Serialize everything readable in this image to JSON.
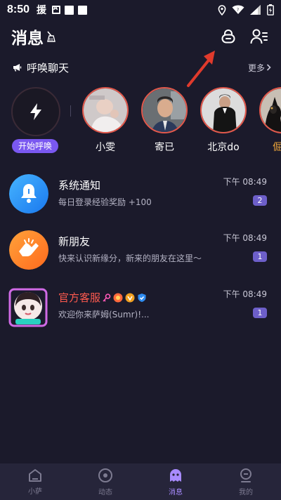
{
  "status_bar": {
    "time": "8:50",
    "glyph": "援"
  },
  "header": {
    "title": "消息",
    "icons": [
      "broom-icon",
      "lock-icon",
      "contacts-icon"
    ]
  },
  "call_section": {
    "title": "呼唤聊天",
    "more_label": "更多",
    "start_label": "开始呼唤",
    "users": [
      {
        "name": "小雯"
      },
      {
        "name": "寄已"
      },
      {
        "name": "北京do"
      },
      {
        "name": "倔强"
      }
    ]
  },
  "conversations": [
    {
      "name": "系统通知",
      "preview": "每日登录经验奖励 +100",
      "time": "下午 08:49",
      "badge": "2"
    },
    {
      "name": "新朋友",
      "preview": "快来认识新缘分，新来的朋友在这里～",
      "time": "下午 08:49",
      "badge": "1"
    },
    {
      "name": "官方客服",
      "preview": "欢迎你来萨姆(Sumr)!...",
      "time": "下午 08:49",
      "badge": "1"
    }
  ],
  "nav": [
    {
      "label": "小萨",
      "icon": "home-icon"
    },
    {
      "label": "动态",
      "icon": "moments-icon"
    },
    {
      "label": "消息",
      "icon": "message-icon",
      "active": true
    },
    {
      "label": "我的",
      "icon": "profile-icon"
    }
  ],
  "colors": {
    "background": "#1b1a2b",
    "accent": "#7a58f0",
    "name_highlight": "#ff5a4e",
    "vip_gold": "#e8a23a"
  }
}
